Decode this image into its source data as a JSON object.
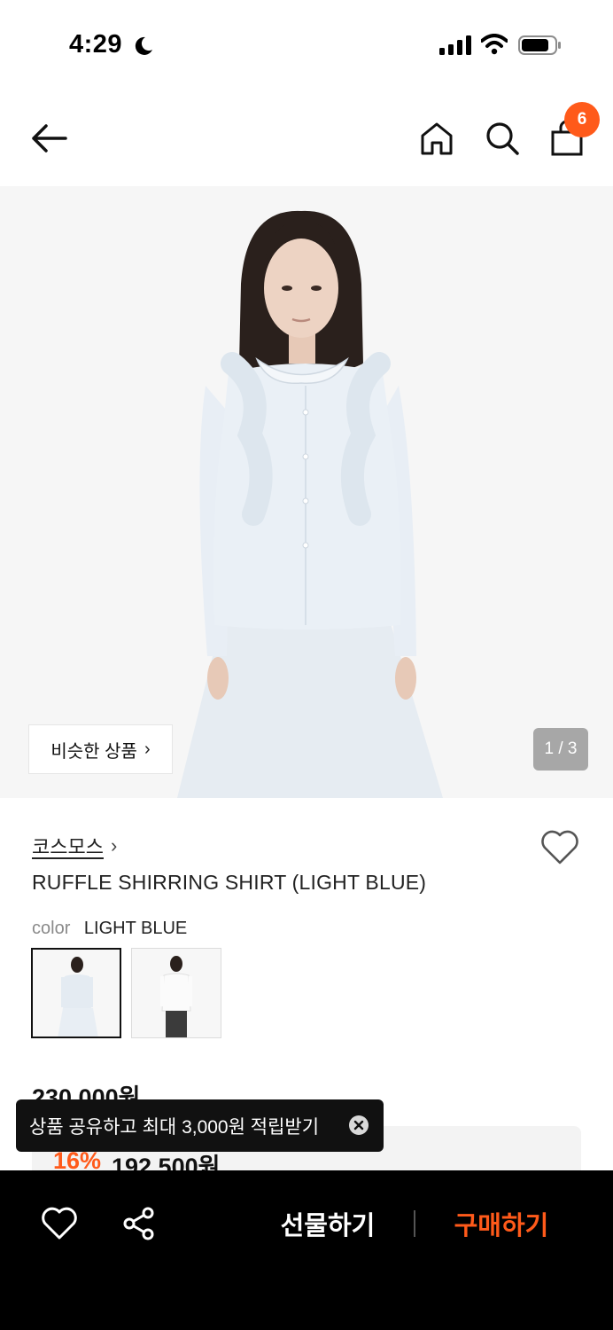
{
  "status_bar": {
    "time": "4:29",
    "icons": [
      "moon-icon",
      "signal-icon",
      "wifi-icon",
      "battery-icon"
    ]
  },
  "nav": {
    "icons": [
      "back-arrow-icon",
      "home-icon",
      "search-icon",
      "shopping-bag-icon"
    ],
    "cart_count": "6"
  },
  "hero": {
    "similar_label": "비슷한 상품",
    "similar_chevron": "›",
    "counter": "1 / 3"
  },
  "product": {
    "brand": "코스모스",
    "brand_chevron": "›",
    "title": "RUFFLE SHIRRING SHIRT (LIGHT BLUE)",
    "color_label": "color",
    "color_value": "LIGHT BLUE",
    "swatches": [
      "LIGHT BLUE",
      "WHITE"
    ],
    "original_price": "230,000원",
    "discount": "16%",
    "sale_price": "192,500원"
  },
  "toast": {
    "text": "상품 공유하고 최대 3,000원 적립받기"
  },
  "bottom_bar": {
    "gift_label": "선물하기",
    "buy_label": "구매하기"
  },
  "colors": {
    "accent": "#ff5a1a",
    "bottom_bar_bg": "#000000",
    "toast_bg": "#111111"
  }
}
